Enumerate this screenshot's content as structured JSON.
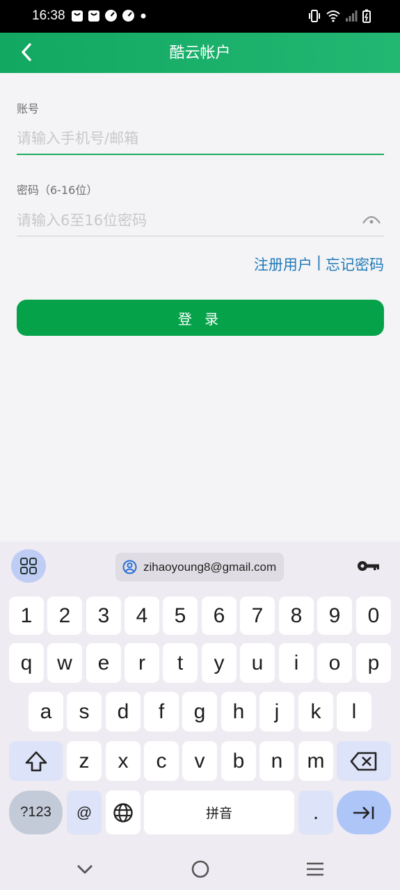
{
  "status_bar": {
    "time": "16:38",
    "icons_left": [
      "bag-icon",
      "bag-icon",
      "gauge-icon",
      "gauge-icon",
      "dot-icon"
    ],
    "icons_right": [
      "vibrate-icon",
      "wifi-icon",
      "signal-icon",
      "battery-charging-icon"
    ]
  },
  "header": {
    "title": "酷云帐户",
    "back_icon": "chevron-left-icon"
  },
  "form": {
    "account_label": "账号",
    "account_placeholder": "请输入手机号/邮箱",
    "account_value": "",
    "password_label": "密码（6-16位）",
    "password_placeholder": "请输入6至16位密码",
    "password_value": "",
    "register_link": "注册用户",
    "separator": "|",
    "forgot_link": "忘记密码",
    "login_button": "登 录"
  },
  "keyboard": {
    "suggestion_email": "zihaoyoung8@gmail.com",
    "row_numbers": [
      "1",
      "2",
      "3",
      "4",
      "5",
      "6",
      "7",
      "8",
      "9",
      "0"
    ],
    "row_1": [
      "q",
      "w",
      "e",
      "r",
      "t",
      "y",
      "u",
      "i",
      "o",
      "p"
    ],
    "row_2": [
      "a",
      "s",
      "d",
      "f",
      "g",
      "h",
      "j",
      "k",
      "l"
    ],
    "row_3": [
      "z",
      "x",
      "c",
      "v",
      "b",
      "n",
      "m"
    ],
    "symbols_key": "?123",
    "at_key": "@",
    "space_key": "拼音",
    "period_key": "."
  },
  "colors": {
    "header_green": "#19b36a",
    "button_green": "#06a24a",
    "link_blue": "#1f7ab9",
    "focused_underline": "#1daa5e"
  }
}
